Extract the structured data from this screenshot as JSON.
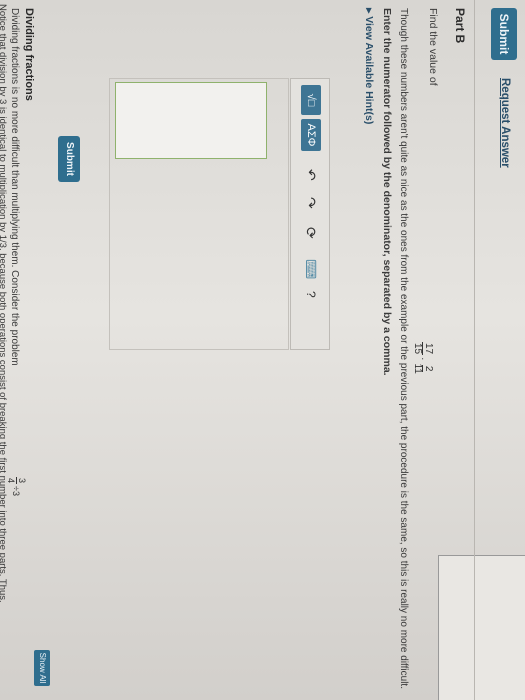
{
  "top": {
    "submit": "Submit",
    "request_answer": "Request Answer"
  },
  "part_b": {
    "title": "Part B",
    "find_value": "Find the value of",
    "expr": {
      "n1": "17",
      "d1": "15",
      "op": "·",
      "n2": "2",
      "d2": "11"
    },
    "paragraph": "Though these numbers aren't quite as nice as the ones from the example or the previous part, the procedure is the same, so this is really no more difficult.",
    "instruction": "Enter the numerator followed by the denominator, separated by a comma.",
    "hints_link": "View Available Hint(s)",
    "toolbar": {
      "templates_label": "√□",
      "symbols_label": "ΑΣΦ",
      "undo_icon": "↶",
      "redo_icon": "↷",
      "reset_icon": "⟳",
      "keyboard_icon": "⌨",
      "help_icon": "?"
    },
    "submit": "Submit"
  },
  "section": {
    "heading": "Dividing fractions",
    "line1": "Dividing fractions is no more difficult than multiplying them. Consider the problem",
    "expr": {
      "n": "3",
      "d": "4",
      "op": "÷",
      "x": "3"
    },
    "line2": "Notice that division by 3 is identical to multiplication by 1/3, because both operations consist of breaking the first number into three parts. Thus,",
    "show_all": "Show All"
  },
  "colors": {
    "primary": "#2f6e8e",
    "link": "#2a4f6a",
    "answer_border": "#8fb26c"
  }
}
